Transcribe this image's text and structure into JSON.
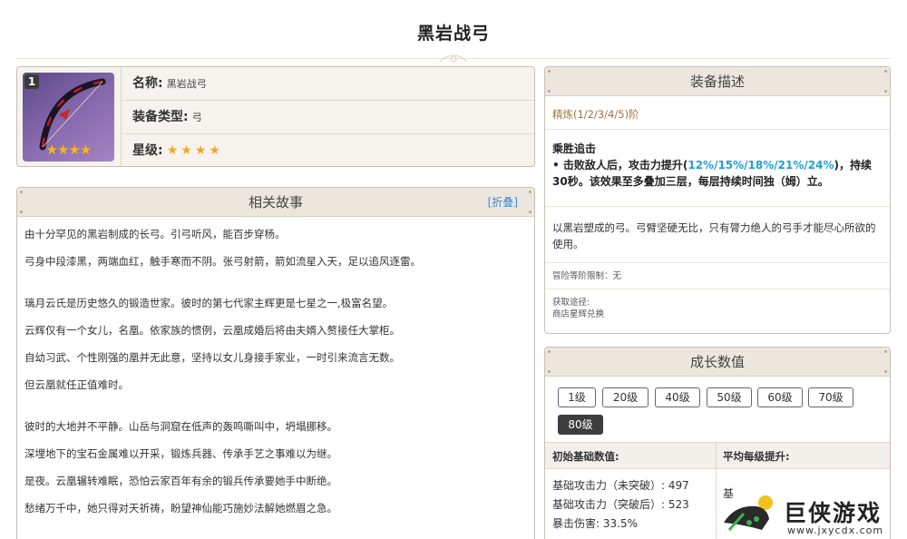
{
  "page": {
    "title": "黑岩战弓"
  },
  "info": {
    "rank": "1",
    "name_label": "名称:",
    "name_value": "黑岩战弓",
    "type_label": "装备类型:",
    "type_value": "弓",
    "star_label": "星级:",
    "star_count": 4
  },
  "story": {
    "title": "相关故事",
    "fold": "[折叠]",
    "paragraphs": [
      "由十分罕见的黑岩制成的长弓。引弓听风，能百步穿杨。",
      "弓身中段漆黑，两端血红，触手寒而不阴。张弓射箭，箭如流星入天，足以追风逐雷。",
      "璃月云氏是历史悠久的锻造世家。彼时的第七代家主辉更是七星之一,极富名望。",
      "云辉仅有一个女儿，名凰。依家族的惯例，云凰成婚后将由夫婿入赘接任大掌柜。",
      "自幼习武、个性刚强的凰并无此意，坚持以女儿身接手家业，一时引来流言无数。",
      "但云凰就任正值难时。",
      "彼时的大地并不平静。山岳与洞窟在低声的轰鸣嘶叫中，坍塌挪移。",
      "深埋地下的宝石金属难以开采，锻炼兵器、传承手艺之事难以为继。",
      "是夜。云凰辗转难眠，恐怕云家百年有余的锻兵传承要她手中断绝。",
      "愁绪万千中，她只得对天祈祷，盼望神仙能巧施妙法解她燃眉之急。"
    ]
  },
  "desc": {
    "title": "装备描述",
    "refine": "精炼(1/2/3/4/5)阶",
    "skill_name": "乘胜追击",
    "skill_pre": "• 击败敌人后，攻击力提升(",
    "skill_values": "12%/15%/18%/21%/24%",
    "skill_post": ")，持续30秒。该效果至多叠加三层，每层持续时间独（姆）立。",
    "flavor": "以黑岩塑成的弓。弓臂坚硬无比，只有膂力绝人的弓手才能尽心所欲的使用。",
    "limit": "冒险等阶限制：无",
    "source_label": "获取途径:",
    "source_value": "商店星辉兑换"
  },
  "growth": {
    "title": "成长数值",
    "levels": [
      "1级",
      "20级",
      "40级",
      "50级",
      "60级",
      "70级",
      "80级"
    ],
    "active_level": "80级",
    "col_base": "初始基础数值:",
    "col_avg": "平均每级提升:",
    "stats": [
      "基础攻击力（未突破）: 497",
      "基础攻击力（突破后）: 523",
      "暴击伤害: 33.5%"
    ],
    "avg_partial": "基"
  },
  "watermark": {
    "brand": "巨侠游戏",
    "url": "www.jxycdx.com"
  },
  "colors": {
    "accent_blue": "#1e9fd6",
    "refine_brown": "#a0733e",
    "star_gold": "#f5a623",
    "header_beige": "#ece6de"
  }
}
